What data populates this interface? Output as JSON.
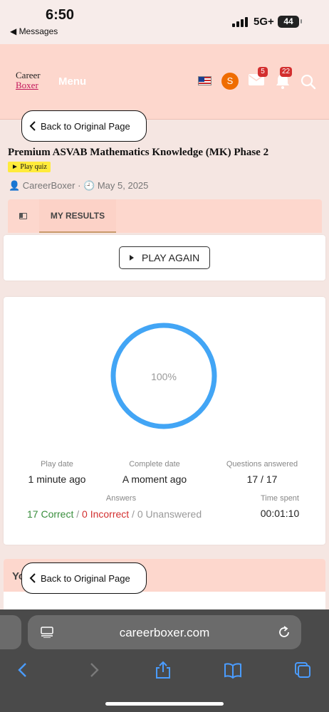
{
  "status": {
    "time": "6:50",
    "back_app": "◀ Messages",
    "network": "5G+",
    "battery": "44"
  },
  "header": {
    "logo_line1": "Career",
    "logo_line2": "Boxer",
    "menu": "Menu",
    "mail_badge": "5",
    "bell_badge": "22",
    "avatar_letter": "S"
  },
  "back_button": {
    "label": "Back to Original Page"
  },
  "quiz": {
    "title": "Premium ASVAB Mathematics Knowledge (MK) Phase 2",
    "play_label": "► Play quiz",
    "meta": "👤 CareerBoxer · 🕘 May 5, 2025"
  },
  "tabs": {
    "active": "MY RESULTS"
  },
  "play_again": "PLAY AGAIN",
  "results": {
    "score_percent": "100%",
    "play_date_label": "Play date",
    "play_date_value": "1 minute ago",
    "complete_date_label": "Complete date",
    "complete_date_value": "A moment ago",
    "questions_answered_label": "Questions answered",
    "questions_answered_value": "17 / 17",
    "answers_label": "Answers",
    "correct": "17 Correct",
    "sep1": " / ",
    "incorrect": "0 Incorrect",
    "sep2": " / ",
    "unanswered": "0 Unanswered",
    "time_spent_label": "Time spent",
    "time_spent_value": "00:01:10"
  },
  "bottom_section": {
    "heading_fragment": "Yo"
  },
  "safari": {
    "url": "careerboxer.com"
  },
  "colors": {
    "header_bg": "#fdd7cd",
    "ring": "#42a5f5",
    "correct": "#388e3c",
    "incorrect": "#d32f2f",
    "badge": "#d32f2f"
  }
}
